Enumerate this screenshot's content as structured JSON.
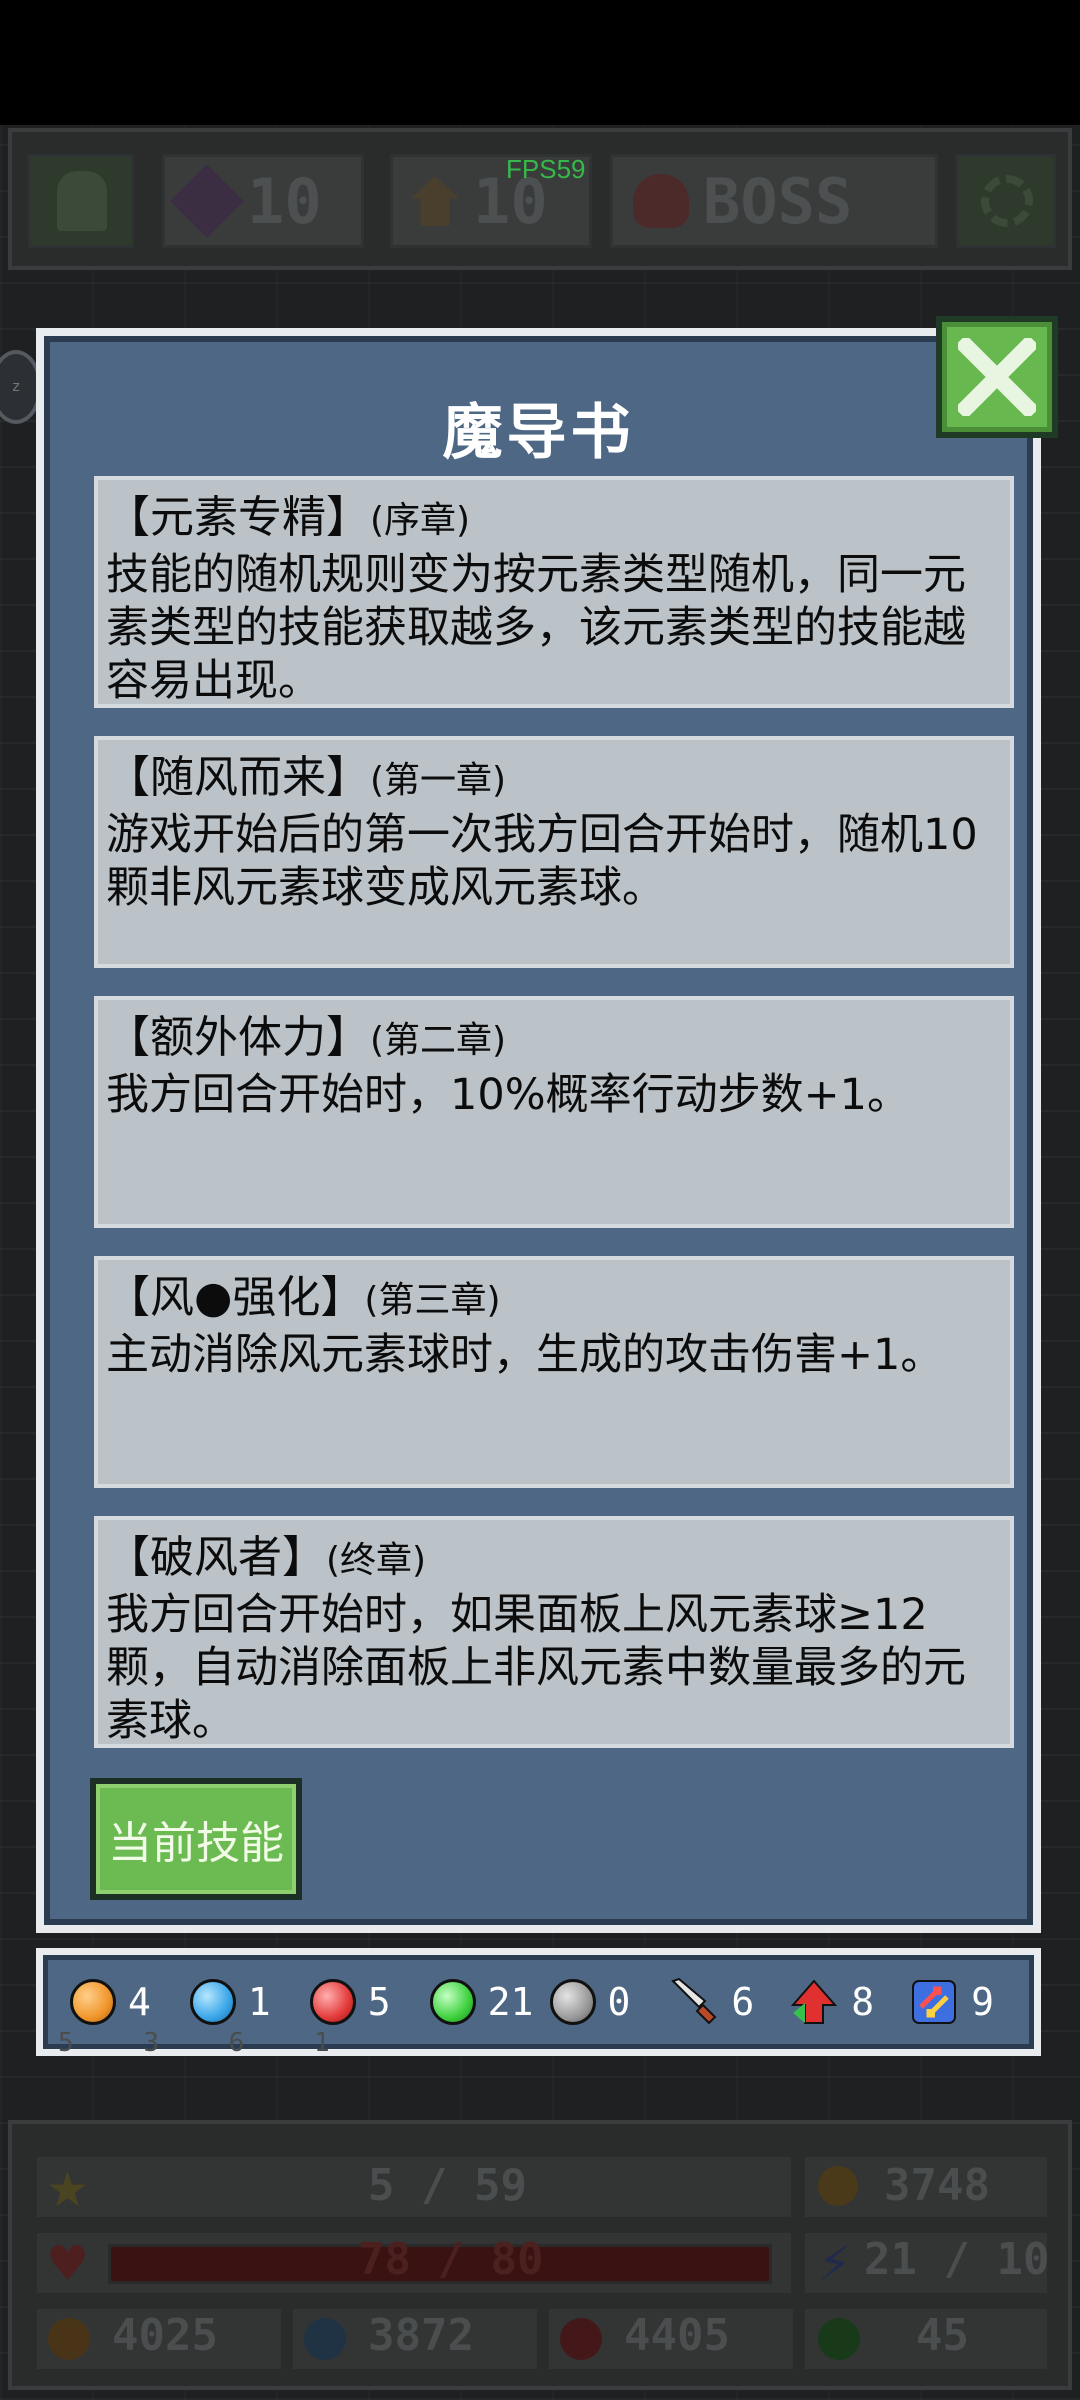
{
  "hud": {
    "fps": "FPS59",
    "gem_count": "10",
    "upgrade_count": "10",
    "boss_label": "BOSS"
  },
  "dialog": {
    "title": "魔导书",
    "cards": [
      {
        "name": "【元素专精】",
        "chapter": "(序章)",
        "desc": "技能的随机规则变为按元素类型随机，同一元素类型的技能获取越多，该元素类型的技能越容易出现。"
      },
      {
        "name": "【随风而来】",
        "chapter": "(第一章)",
        "desc": "游戏开始后的第一次我方回合开始时，随机10颗非风元素球变成风元素球。"
      },
      {
        "name": "【额外体力】",
        "chapter": "(第二章)",
        "desc": "我方回合开始时，10%概率行动步数+1。"
      },
      {
        "name": "【风●强化】",
        "chapter": "(第三章)",
        "desc": "主动消除风元素球时，生成的攻击伤害+1。"
      },
      {
        "name": "【破风者】",
        "chapter": "(终章)",
        "desc": "我方回合开始时，如果面板上风元素球≥12颗，自动消除面板上非风元素中数量最多的元素球。"
      }
    ],
    "current_skill_button": "当前技能"
  },
  "resources": [
    {
      "icon": "orange-orb-icon",
      "color": "#f0962c",
      "count": "4"
    },
    {
      "icon": "blue-orb-icon",
      "color": "#3aa6e8",
      "count": "1"
    },
    {
      "icon": "red-orb-icon",
      "color": "#e33a3a",
      "count": "5"
    },
    {
      "icon": "green-orb-icon",
      "color": "#3ed13e",
      "count": "21"
    },
    {
      "icon": "gray-orb-icon",
      "color": "#9a9a9a",
      "count": "0"
    },
    {
      "icon": "sword-icon",
      "color": "#d9d9d9",
      "count": "6"
    },
    {
      "icon": "arrow-up-icon",
      "color": "#e03030",
      "count": "8"
    },
    {
      "icon": "swap-icon",
      "color": "#4070e0",
      "count": "9"
    }
  ],
  "minis": [
    "5",
    "3",
    "6",
    "1"
  ],
  "stats": {
    "level": "5 / 59",
    "gold": "3748",
    "hp": "78 / 80",
    "energy": "21 / 10",
    "orange": "4025",
    "blue": "3872",
    "red": "4405",
    "green": "45"
  }
}
